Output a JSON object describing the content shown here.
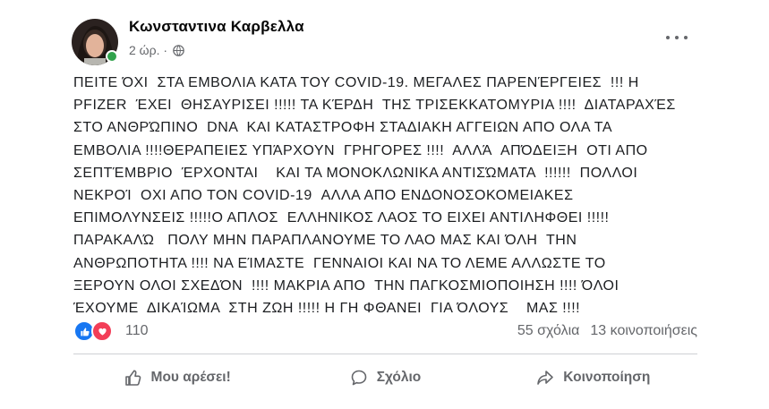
{
  "post": {
    "author": "Κωνσταντινα Καρβελλα",
    "time": "2 ώρ. ·",
    "text": "ΠΕΙΤΕ ΌΧΙ  ΣΤΑ ΕΜΒΟΛΙΑ ΚΑΤΑ ΤΟΥ COVID-19. ΜΕΓΑΛΕΣ ΠΑΡΕΝΈΡΓΕΙΕΣ  !!! Η\nPFIZER  ΈΧΕΙ  ΘΗΣΑΥΡΙΣΕΙ !!!!! ΤΑ ΚΈΡΔΗ  ΤΗΣ ΤΡΙΣΕΚΚΑΤΟΜΥΡΙΑ !!!!  ΔΙΑΤΑΡΑΧΈΣ\nΣΤΟ ΑΝΘΡΏΠΙΝΟ  DNA  ΚΑΙ ΚΑΤΑΣΤΡΟΦΗ ΣΤΑΔΙΑΚΗ ΑΓΓΕΙΩΝ ΑΠΟ ΟΛΑ ΤΑ\nΕΜΒΟΛΙΑ !!!!ΘΕΡΑΠΕΙΕΣ ΥΠΆΡΧΟΥΝ  ΓΡΗΓΟΡΕΣ !!!!  ΑΛΛΆ  ΑΠΌΔΕΙΞΗ  ΟΤΙ ΑΠΟ\nΣΕΠΤΈΜΒΡΙΟ  ΈΡΧΟΝΤΑΙ    ΚΑΙ ΤΑ ΜΟΝΟΚΛΩΝΙΚΑ ΑΝΤΙΣΏΜΑΤΑ  !!!!!!  ΠΟΛΛΟΙ\nΝΕΚΡΟΊ  ΟΧΙ ΑΠΟ ΤΟΝ COVID-19  ΑΛΛΑ ΑΠΟ ΕΝΔΟΝΟΣΟΚΟΜΕΙΑΚΕΣ\nΕΠΙΜΟΛΥΝΣΕΙΣ !!!!!Ο ΑΠΛΟΣ  ΕΛΛΗΝΙΚΟΣ ΛΑΟΣ ΤΟ ΕΙΧΕΙ ΑΝΤΙΛΗΦΘΕΙ !!!!!\nΠΑΡΑΚΑΛΏ   ΠΟΛΥ ΜΗΝ ΠΑΡΑΠΛΑΝΟΥΜΕ ΤΟ ΛΑΟ ΜΑΣ ΚΑΙ ΌΛΗ  ΤΗΝ\nΑΝΘΡΩΠΟΤΗΤΑ !!!! ΝΑ ΕΊΜΑΣΤΕ  ΓΕΝΝΑΙΟΙ ΚΑΙ ΝΑ ΤΟ ΛΕΜΕ ΑΛΛΩΣΤΕ ΤΟ\nΞΕΡΟΥΝ ΟΛΟΙ ΣΧΕΔΌΝ  !!!! ΜΑΚΡΙΑ ΑΠΟ  ΤΗΝ ΠΑΓΚΟΣΜΙΟΠΟΙΗΣΗ !!!! ΌΛΟΙ\nΈΧΟΥΜΕ  ΔΙΚΑΊΩΜΑ  ΣΤΗ ΖΩΗ !!!!! Η ΓΗ ΦΘΑΝΕΙ  ΓΙΑ ΌΛΟΥΣ    ΜΑΣ !!!!",
    "reaction_count": "110",
    "comments": "55 σχόλια",
    "shares": "13 κοινοποιήσεις"
  },
  "actions": {
    "like": "Μου αρέσει!",
    "comment": "Σχόλιο",
    "share": "Κοινοποίηση"
  },
  "icons": {
    "privacy": "globe-icon",
    "menu": "more-options-icon",
    "reactions": [
      "like-reaction-icon",
      "love-reaction-icon"
    ],
    "like": "thumbs-up-icon",
    "comment": "comment-bubble-icon",
    "share": "share-arrow-icon"
  },
  "colors": {
    "like_blue": "#1877f2",
    "love_red": "#f33e58",
    "online_green": "#31a24c",
    "secondary_text": "#65676b"
  }
}
